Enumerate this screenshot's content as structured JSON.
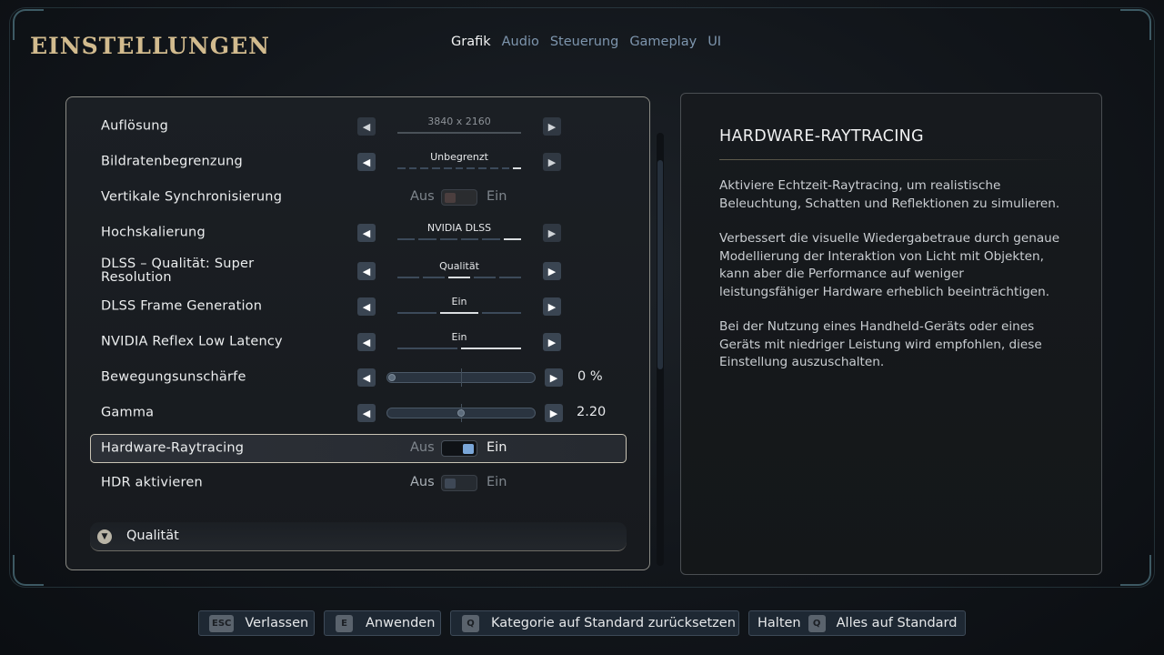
{
  "header": {
    "title": "EINSTELLUNGEN",
    "tabs": [
      {
        "label": "Grafik",
        "active": true
      },
      {
        "label": "Audio"
      },
      {
        "label": "Steuerung"
      },
      {
        "label": "Gameplay"
      },
      {
        "label": "UI"
      }
    ]
  },
  "settings": {
    "resolution": {
      "label": "Auflösung",
      "value": "3840 x 2160"
    },
    "framerate": {
      "label": "Bildratenbegrenzung",
      "value": "Unbegrenzt"
    },
    "vsync": {
      "label": "Vertikale Synchronisierung",
      "off": "Aus",
      "on": "Ein"
    },
    "upscaling": {
      "label": "Hochskalierung",
      "value": "NVIDIA DLSS"
    },
    "dlss_quality": {
      "label": "DLSS – Qualität: Super Resolution",
      "value": "Qualität"
    },
    "frame_gen": {
      "label": "DLSS Frame Generation",
      "value": "Ein"
    },
    "reflex": {
      "label": "NVIDIA Reflex Low Latency",
      "value": "Ein"
    },
    "motion_blur": {
      "label": "Bewegungsunschärfe",
      "value": "0 %",
      "level": 0
    },
    "gamma": {
      "label": "Gamma",
      "value": "2.20",
      "level": 0.5
    },
    "raytracing": {
      "label": "Hardware-Raytracing",
      "off": "Aus",
      "on": "Ein",
      "enabled": true
    },
    "hdr": {
      "label": "HDR aktivieren",
      "off": "Aus",
      "on": "Ein",
      "enabled": false
    },
    "quality_section": {
      "label": "Qualität"
    }
  },
  "description": {
    "title": "HARDWARE-RAYTRACING",
    "p1": "Aktiviere Echtzeit-Raytracing, um realistische Beleuchtung, Schatten und Reflektionen zu simulieren.",
    "p2": "Verbessert die visuelle Wiedergabetraue durch genaue Modellierung der Interaktion von Licht mit Objekten, kann aber die Performance auf weniger leistungsfähiger Hardware erheblich beeinträchtigen.",
    "p3": "Bei der Nutzung eines Handheld-Geräts oder eines Geräts mit niedriger Leistung wird empfohlen, diese Einstellung auszuschalten."
  },
  "footer": {
    "leave": {
      "key": "ESC",
      "label": "Verlassen"
    },
    "apply": {
      "key": "E",
      "label": "Anwenden"
    },
    "reset_category": {
      "key": "Q",
      "label": "Kategorie auf Standard zurücksetzen"
    },
    "reset_all": {
      "prefix": "Halten",
      "key": "Q",
      "label": "Alles auf Standard"
    }
  }
}
